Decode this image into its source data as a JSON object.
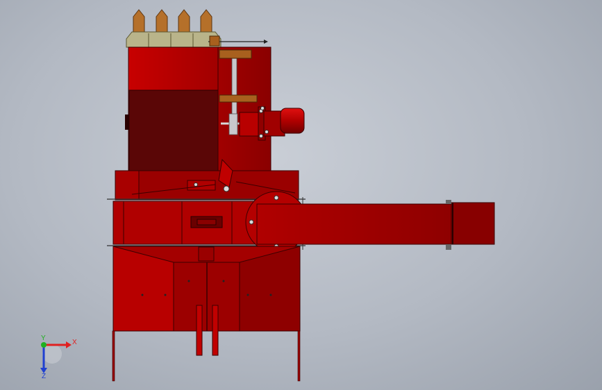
{
  "triad": {
    "x_label": "X",
    "y_label": "Y",
    "z_label": "Z"
  },
  "colors": {
    "background": "#b9bec7",
    "body_red": "#b40000",
    "body_dark": "#7a0000",
    "window_dark": "#5a0606",
    "edge": "#3a0000",
    "teeth_brown": "#b5702a",
    "base_olive": "#b9b48a",
    "shaft_gray": "#c8c8cc",
    "axis_x": "#e02020",
    "axis_y": "#20b020",
    "axis_z": "#2040d0"
  }
}
